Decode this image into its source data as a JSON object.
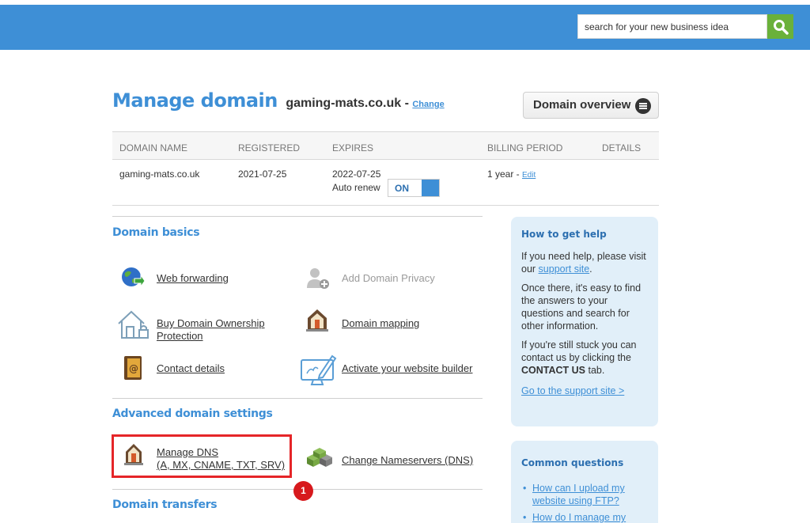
{
  "header": {
    "search_value": "search for your new business idea",
    "accent": "#3e8fd6",
    "search_button_color": "#6ab13a"
  },
  "page": {
    "title": "Manage domain",
    "domain": "gaming-mats.co.uk",
    "separator": " - ",
    "change_label": "Change",
    "overview_button": "Domain overview"
  },
  "table": {
    "headers": [
      "DOMAIN NAME",
      "REGISTERED",
      "EXPIRES",
      "BILLING PERIOD",
      "DETAILS"
    ],
    "row": {
      "domain": "gaming-mats.co.uk",
      "registered": "2021-07-25",
      "expires": "2022-07-25",
      "auto_renew_label": "Auto renew",
      "auto_renew_state": "ON",
      "billing_period": "1 year - ",
      "edit_label": "Edit"
    }
  },
  "sections": {
    "basics": {
      "title": "Domain basics",
      "web_forwarding": "Web forwarding",
      "add_privacy": "Add Domain Privacy",
      "buy_protection_1": "Buy Domain Ownership",
      "buy_protection_2": "Protection",
      "domain_mapping": "Domain mapping",
      "contact_details": "Contact details",
      "website_builder": "Activate your website builder"
    },
    "advanced": {
      "title": "Advanced domain settings",
      "manage_dns_1": "Manage DNS",
      "manage_dns_2": "(A, MX, CNAME, TXT, SRV)",
      "change_nameservers": "Change Nameservers (DNS)"
    },
    "transfers": {
      "title": "Domain transfers"
    }
  },
  "help": {
    "title": "How to get help",
    "p1_a": "If you need help, please visit our ",
    "p1_link": "support site",
    "p1_b": ".",
    "p2": "Once there, it's easy to find the answers to your questions and search for other information.",
    "p3_a": "If you're still stuck you can contact us by clicking the ",
    "p3_bold": "CONTACT US",
    "p3_b": " tab.",
    "support_link": "Go to the support site >"
  },
  "questions": {
    "title": "Common questions",
    "items": [
      "How can I upload my website using FTP?",
      "How do I manage my"
    ]
  },
  "annotation": {
    "badge": "1"
  }
}
